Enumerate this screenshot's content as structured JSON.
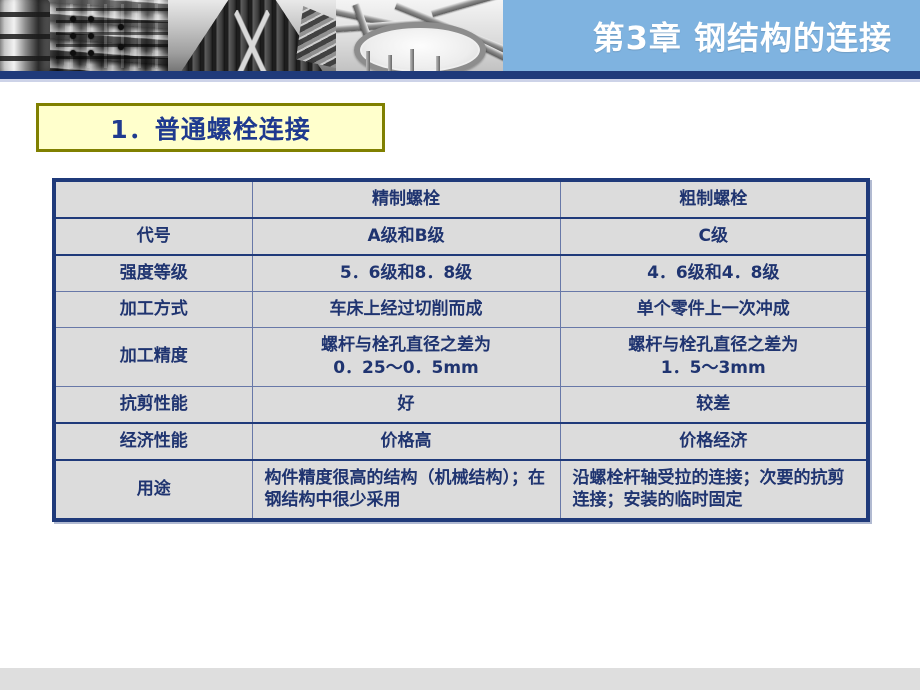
{
  "header": {
    "title": "第3章  钢结构的连接",
    "background_color": "#7fb3e0",
    "rule_color": "#1f3a7a",
    "photos": [
      {
        "name": "industrial-building-photo",
        "caption": "industrial building facade"
      },
      {
        "name": "skyscraper-photo",
        "caption": "skyscraper from below"
      },
      {
        "name": "steel-truss-photo",
        "caption": "steel roof truss"
      }
    ]
  },
  "section": {
    "title": "1．普通螺栓连接",
    "fill_color": "#ffffcc",
    "border_color": "#808000",
    "text_color": "#1f3a8f"
  },
  "table": {
    "columns": [
      "",
      "精制螺栓",
      "粗制螺栓"
    ],
    "column_colors": [
      "#1f3470",
      "#00a000",
      "#49a6e8"
    ],
    "rows": [
      {
        "label": "代号",
        "fine": "A级和B级",
        "rough": "C级"
      },
      {
        "label": "强度等级",
        "fine": "5．6级和8．8级",
        "rough": "4．6级和4．8级"
      },
      {
        "label": "加工方式",
        "fine": "车床上经过切削而成",
        "rough": "单个零件上一次冲成"
      },
      {
        "label": "加工精度",
        "fine": "螺杆与栓孔直径之差为\n0．25～0．5mm",
        "rough": "螺杆与栓孔直径之差为\n1．5～3mm"
      },
      {
        "label": "抗剪性能",
        "fine": "好",
        "rough": "较差"
      },
      {
        "label": "经济性能",
        "fine": "价格高",
        "rough": "价格经济"
      },
      {
        "label": "用途",
        "fine": "构件精度很高的结构（机械结构）；在钢结构中很少采用",
        "rough": "沿螺栓杆轴受拉的连接；次要的抗剪连接；安装的临时固定"
      }
    ],
    "border_color": "#1f3a7a",
    "cell_background": "#dcdcdc"
  },
  "footer": {
    "band_color": "#dedede"
  }
}
